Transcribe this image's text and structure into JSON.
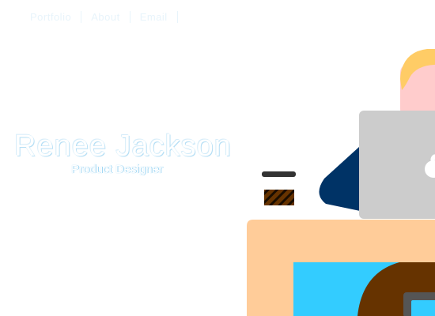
{
  "nav": {
    "items": [
      {
        "label": "Portfolio"
      },
      {
        "label": "About"
      },
      {
        "label": "Email"
      }
    ]
  },
  "hero": {
    "name": "Renee Jackson",
    "role": "Product Designer"
  },
  "colors": {
    "desk": "#ffcc99",
    "laptop": "#cccccc",
    "sleeve": "#003366",
    "hair": "#ffcc66",
    "skin": "#ffcccc",
    "chair": "#33ccff",
    "legs": "#663300",
    "coffee_sleeve": "#663300",
    "coffee_lid": "#333333"
  },
  "icons": [
    "apple-logo-icon",
    "coffee-cup-icon"
  ]
}
